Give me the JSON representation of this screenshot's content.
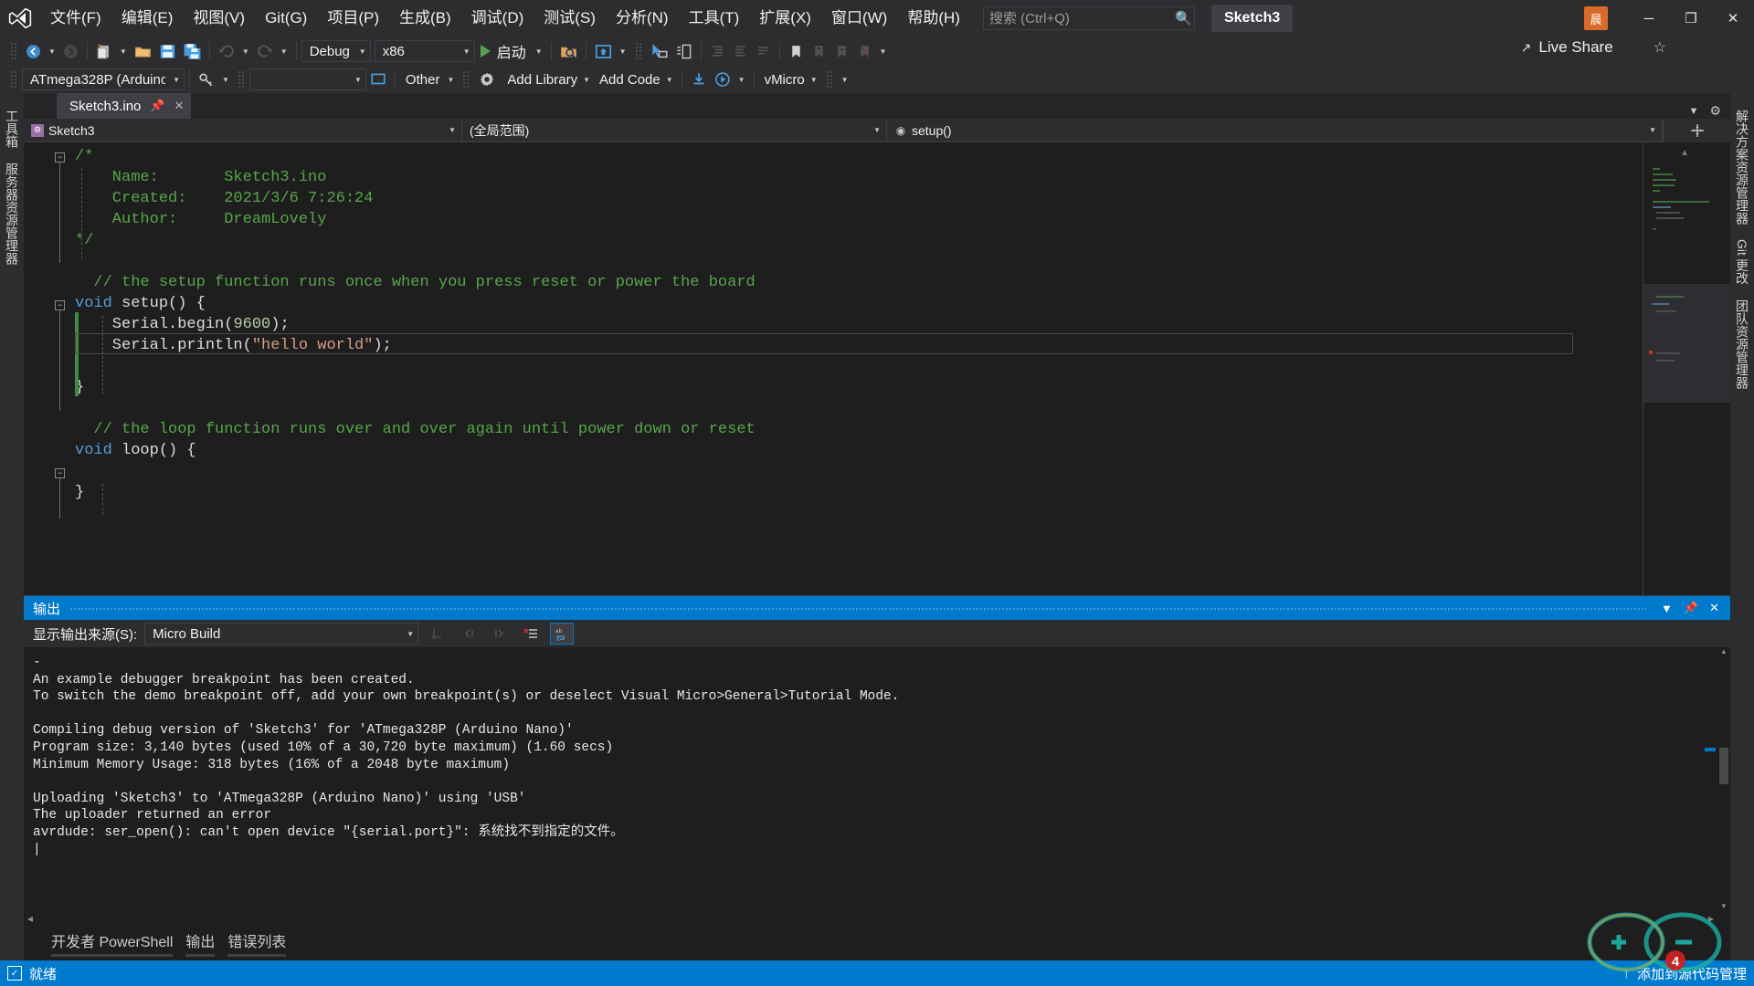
{
  "titlebar": {
    "logo_icon": "visual-studio-logo",
    "menus": [
      {
        "label": "文件(F)"
      },
      {
        "label": "编辑(E)"
      },
      {
        "label": "视图(V)"
      },
      {
        "label": "Git(G)"
      },
      {
        "label": "项目(P)"
      },
      {
        "label": "生成(B)"
      },
      {
        "label": "调试(D)"
      },
      {
        "label": "测试(S)"
      },
      {
        "label": "分析(N)"
      },
      {
        "label": "工具(T)"
      },
      {
        "label": "扩展(X)"
      },
      {
        "label": "窗口(W)"
      },
      {
        "label": "帮助(H)"
      }
    ],
    "search": {
      "placeholder": "搜索 (Ctrl+Q)",
      "value": "",
      "icon": "search-icon"
    },
    "solution_name": "Sketch3",
    "live_share": "Live Share",
    "account_badge": "晨",
    "window_buttons": {
      "minimize": "─",
      "maximize": "❐",
      "close": "✕"
    }
  },
  "toolbar1": {
    "nav_back_icon": "arrow-back-icon",
    "nav_forward_icon": "arrow-forward-icon",
    "new_icon": "new-file-icon",
    "open_icon": "open-folder-icon",
    "save_icon": "save-icon",
    "save_all_icon": "save-all-icon",
    "undo_icon": "undo-icon",
    "redo_icon": "redo-icon",
    "config_combo": "Debug",
    "platform_combo": "x86",
    "run_label": "启动",
    "run_icon": "play-icon",
    "attach_icon": "attach-folder-icon",
    "home_icon": "home-window-icon",
    "pointer_icon": "pointer-select-icon",
    "compare_icon": "compare-icon",
    "indent_icon": "indent-icon",
    "outdent_icon": "outdent-icon",
    "comment_icon": "comment-icon",
    "bookmark_icon": "bookmark-icon",
    "bookmark_prev_icon": "bookmark-prev-icon",
    "bookmark_next_icon": "bookmark-next-icon",
    "bookmark_clear_icon": "bookmark-clear-icon"
  },
  "toolbar2": {
    "board_combo": "ATmega328P (Arduino",
    "key_icon": "key-icon",
    "port_combo": "",
    "monitor_icon": "serial-monitor-icon",
    "other_combo": "Other",
    "gear_icon": "gear-icon",
    "add_library": "Add Library",
    "add_code": "Add Code",
    "download_icon": "download-icon",
    "debug_run_icon": "debug-run-icon",
    "vmicro_menu": "vMicro"
  },
  "left_dock": [
    {
      "label": "工具箱"
    },
    {
      "label": "服务器资源管理器"
    }
  ],
  "right_dock": [
    {
      "label": "解决方案资源管理器"
    },
    {
      "label": "Git 更改"
    },
    {
      "label": "团队资源管理器"
    }
  ],
  "editor": {
    "tab": {
      "label": "Sketch3.ino",
      "pin_icon": "pin-icon",
      "close_icon": "close-icon"
    },
    "navbar": {
      "project": "Sketch3",
      "scope": "(全局范围)",
      "member": "setup()",
      "project_icon": "project-file-icon",
      "member_icon": "method-icon",
      "split_icon": "split-view-icon"
    },
    "lines": [
      {
        "indent": 0,
        "segments": [
          {
            "t": "/*",
            "c": "c-com"
          }
        ]
      },
      {
        "indent": 0,
        "segments": [
          {
            "t": "    Name:       Sketch3.ino",
            "c": "c-com"
          }
        ]
      },
      {
        "indent": 0,
        "segments": [
          {
            "t": "    Created:\t2021/3/6 7:26:24",
            "c": "c-com"
          }
        ]
      },
      {
        "indent": 0,
        "segments": [
          {
            "t": "    Author:     DreamLovely",
            "c": "c-com"
          }
        ]
      },
      {
        "indent": 0,
        "segments": [
          {
            "t": "*/",
            "c": "c-com"
          }
        ]
      },
      {
        "indent": 0,
        "segments": [
          {
            "t": "",
            "c": "c-id"
          }
        ]
      },
      {
        "indent": 0,
        "segments": [
          {
            "t": "  // the setup function runs once when you press reset or power the board",
            "c": "c-com"
          }
        ]
      },
      {
        "indent": 0,
        "segments": [
          {
            "t": "void",
            "c": "c-kw"
          },
          {
            "t": " setup() {",
            "c": "c-id"
          }
        ]
      },
      {
        "indent": 0,
        "segments": [
          {
            "t": "    Serial.begin(",
            "c": "c-id"
          },
          {
            "t": "9600",
            "c": "c-num"
          },
          {
            "t": ");",
            "c": "c-id"
          }
        ]
      },
      {
        "indent": 0,
        "segments": [
          {
            "t": "    Serial.println(",
            "c": "c-id"
          },
          {
            "t": "\"hello world\"",
            "c": "c-str"
          },
          {
            "t": ");",
            "c": "c-id"
          }
        ]
      },
      {
        "indent": 0,
        "segments": [
          {
            "t": "",
            "c": "c-id"
          }
        ]
      },
      {
        "indent": 0,
        "segments": [
          {
            "t": "}",
            "c": "c-id"
          }
        ]
      },
      {
        "indent": 0,
        "segments": [
          {
            "t": "",
            "c": "c-id"
          }
        ]
      },
      {
        "indent": 0,
        "segments": [
          {
            "t": "  // the loop function runs over and over again until power down or reset",
            "c": "c-com"
          }
        ]
      },
      {
        "indent": 0,
        "segments": [
          {
            "t": "void",
            "c": "c-kw"
          },
          {
            "t": " loop() {",
            "c": "c-id"
          }
        ]
      },
      {
        "indent": 0,
        "segments": [
          {
            "t": "",
            "c": "c-id"
          }
        ]
      },
      {
        "indent": 0,
        "segments": [
          {
            "t": "}",
            "c": "c-id"
          }
        ]
      }
    ],
    "breakpoint_icon": "breakpoint-icon"
  },
  "output": {
    "title": "输出",
    "header_icons": {
      "dropdown": "chevron-down-icon",
      "dock": "dock-icon",
      "close": "close-icon"
    },
    "source_label": "显示输出来源(S):",
    "source_value": "Micro Build",
    "toolbar_icons": {
      "goto_icon": "goto-message-icon",
      "prev_icon": "prev-message-icon",
      "next_icon": "next-message-icon",
      "clear_icon": "clear-all-icon",
      "wordwrap_icon": "word-wrap-icon"
    },
    "text": "-\nAn example debugger breakpoint has been created.\nTo switch the demo breakpoint off, add your own breakpoint(s) or deselect Visual Micro>General>Tutorial Mode.\n\nCompiling debug version of 'Sketch3' for 'ATmega328P (Arduino Nano)'\nProgram size: 3,140 bytes (used 10% of a 30,720 byte maximum) (1.60 secs)\nMinimum Memory Usage: 318 bytes (16% of a 2048 byte maximum)\n\nUploading 'Sketch3' to 'ATmega328P (Arduino Nano)' using 'USB'\nThe uploader returned an error\navrdude: ser_open(): can't open device \"{serial.port}\": 系统找不到指定的文件。\n|"
  },
  "bottom_tabs": [
    {
      "label": "开发者 PowerShell",
      "active": false
    },
    {
      "label": "输出",
      "active": true
    },
    {
      "label": "错误列表",
      "active": false
    }
  ],
  "statusbar": {
    "ready_text": "就绪",
    "ready_icon": "checkbox-icon",
    "source_control": "添加到源代码管理",
    "source_control_icon": "upload-arrow-icon"
  },
  "colors": {
    "accent": "#007acc",
    "chrome": "#2d2d30",
    "editor_bg": "#1e1e1e",
    "comment": "#57a64a",
    "keyword": "#569cd6",
    "string": "#d69d85",
    "number": "#b5cea8",
    "breakpoint": "#e51400",
    "run_green": "#54a254",
    "badge_orange": "#d86a2a"
  }
}
